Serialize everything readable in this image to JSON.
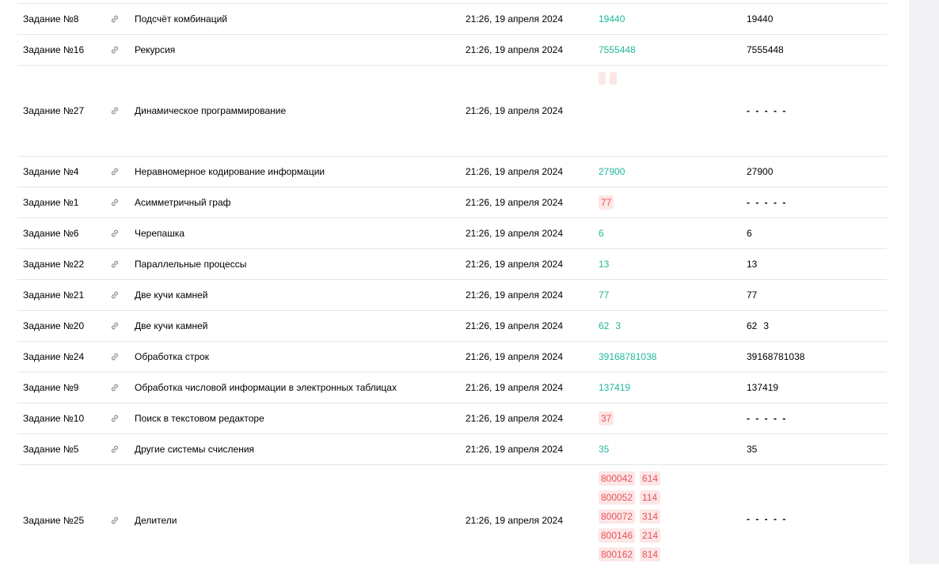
{
  "colors": {
    "correct": "#1fb89a",
    "wrong_bg": "#fde6e6",
    "wrong_text": "#e5545c"
  },
  "rows": [
    {
      "task": "Задание №8",
      "title": "Подсчёт комбинаций",
      "date": "21:26, 19 апреля 2024",
      "answer": [
        "19440"
      ],
      "answer_ok": true,
      "correct": "19440"
    },
    {
      "task": "Задание №16",
      "title": "Рекурсия",
      "date": "21:26, 19 апреля 2024",
      "answer": [
        "7555448"
      ],
      "answer_ok": true,
      "correct": "7555448"
    },
    {
      "task": "Задание №27",
      "title": "Динамическое программирование",
      "date": "21:26, 19 апреля 2024",
      "answer": [],
      "answer_ok": false,
      "correct": "- - - - -"
    },
    {
      "task": "Задание №4",
      "title": "Неравномерное кодирование информации",
      "date": "21:26, 19 апреля 2024",
      "answer": [
        "27900"
      ],
      "answer_ok": true,
      "correct": "27900"
    },
    {
      "task": "Задание №1",
      "title": "Асимметричный граф",
      "date": "21:26, 19 апреля 2024",
      "answer": [
        "77"
      ],
      "answer_ok": false,
      "correct": "- - - - -"
    },
    {
      "task": "Задание №6",
      "title": "Черепашка",
      "date": "21:26, 19 апреля 2024",
      "answer": [
        "6"
      ],
      "answer_ok": true,
      "correct": "6"
    },
    {
      "task": "Задание №22",
      "title": "Параллельные процессы",
      "date": "21:26, 19 апреля 2024",
      "answer": [
        "13"
      ],
      "answer_ok": true,
      "correct": "13"
    },
    {
      "task": "Задание №21",
      "title": "Две кучи камней",
      "date": "21:26, 19 апреля 2024",
      "answer": [
        "77"
      ],
      "answer_ok": true,
      "correct": "77"
    },
    {
      "task": "Задание №20",
      "title": "Две кучи камней",
      "date": "21:26, 19 апреля 2024",
      "answer": [
        "62",
        "3"
      ],
      "answer_ok": true,
      "correct": [
        "62",
        "3"
      ]
    },
    {
      "task": "Задание №24",
      "title": "Обработка строк",
      "date": "21:26, 19 апреля 2024",
      "answer": [
        "39168781038"
      ],
      "answer_ok": true,
      "correct": "39168781038"
    },
    {
      "task": "Задание №9",
      "title": "Обработка числовой информации в электронных таблицах",
      "date": "21:26, 19 апреля 2024",
      "answer": [
        "137419"
      ],
      "answer_ok": true,
      "correct": "137419"
    },
    {
      "task": "Задание №10",
      "title": "Поиск в текстовом редакторе",
      "date": "21:26, 19 апреля 2024",
      "answer": [
        "37"
      ],
      "answer_ok": false,
      "correct": "- - - - -"
    },
    {
      "task": "Задание №5",
      "title": "Другие системы счисления",
      "date": "21:26, 19 апреля 2024",
      "answer": [
        "35"
      ],
      "answer_ok": true,
      "correct": "35"
    },
    {
      "task": "Задание №25",
      "title": "Делители",
      "date": "21:26, 19 апреля 2024",
      "answer": [
        "800042",
        "614",
        "800052",
        "114",
        "800072",
        "314",
        "800146",
        "214",
        "800162",
        "814"
      ],
      "answer_ok": false,
      "correct": "- - - - -"
    }
  ]
}
